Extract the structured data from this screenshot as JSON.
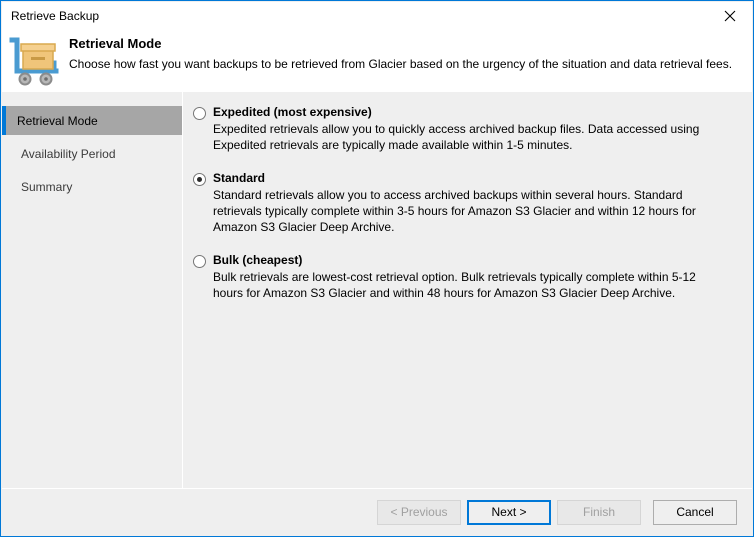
{
  "window": {
    "title": "Retrieve Backup",
    "close_icon": "close-icon",
    "accent_color": "#0078d7",
    "background_color": "#efefef",
    "header_background": "#ffffff",
    "selected_nav_background": "#a6a6a6"
  },
  "header": {
    "icon": "cart-with-box-icon",
    "title": "Retrieval Mode",
    "subtitle": "Choose how fast you want backups to be retrieved from Glacier based on the urgency of the situation and data retrieval fees."
  },
  "sidebar": {
    "items": [
      {
        "label": "Retrieval Mode",
        "selected": true
      },
      {
        "label": "Availability Period",
        "selected": false
      },
      {
        "label": "Summary",
        "selected": false
      }
    ]
  },
  "options": [
    {
      "id": "expedited",
      "label": "Expedited (most expensive)",
      "selected": false,
      "description": "Expedited retrievals allow you to quickly access archived backup files. Data accessed using Expedited retrievals are typically made available within 1-5 minutes."
    },
    {
      "id": "standard",
      "label": "Standard",
      "selected": true,
      "description": "Standard retrievals allow you to access archived backups within several hours. Standard retrievals typically complete within 3-5 hours for Amazon S3 Glacier and within 12 hours for Amazon S3 Glacier Deep Archive."
    },
    {
      "id": "bulk",
      "label": "Bulk (cheapest)",
      "selected": false,
      "description": "Bulk retrievals are lowest-cost retrieval option. Bulk retrievals typically complete within 5-12 hours for Amazon S3 Glacier and within 48 hours for Amazon S3 Glacier Deep Archive."
    }
  ],
  "footer": {
    "previous_label": "< Previous",
    "next_label": "Next >",
    "finish_label": "Finish",
    "cancel_label": "Cancel"
  }
}
